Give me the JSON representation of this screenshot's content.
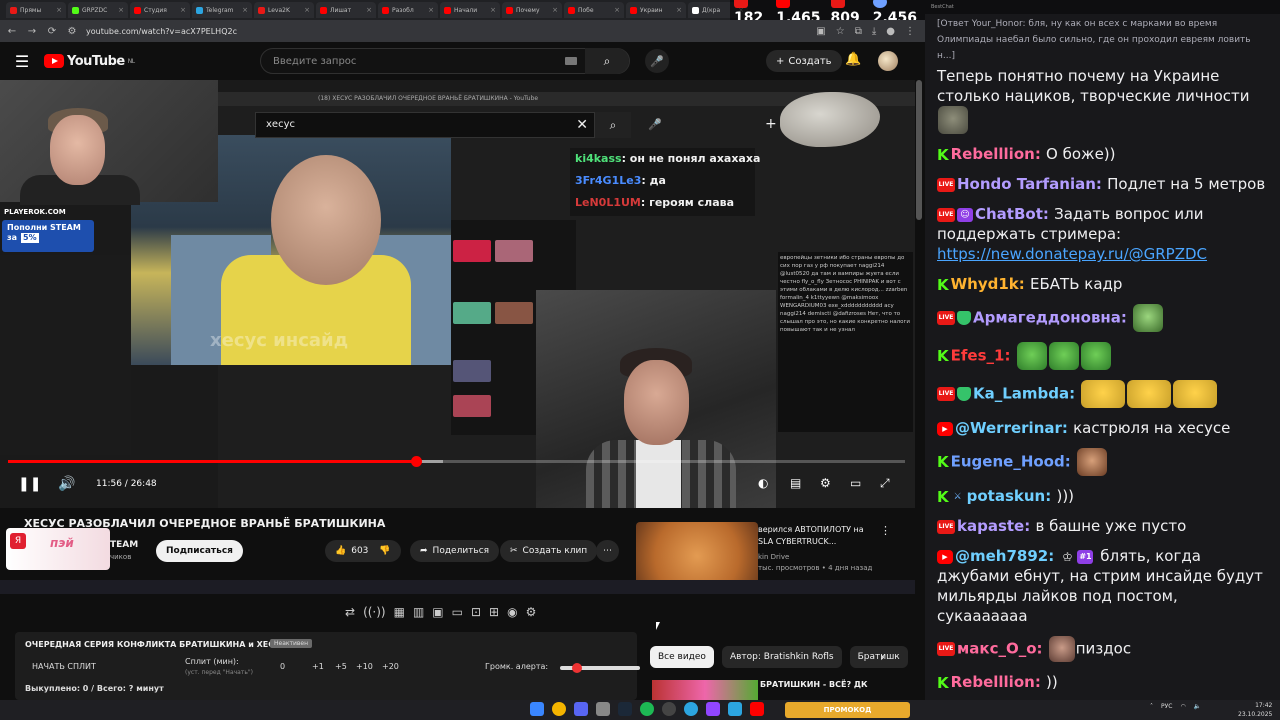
{
  "browser": {
    "tabs": [
      "Прямы",
      "GRPZDC",
      "Студия",
      "Telegram",
      "Leva2K",
      "Лишат",
      "Разобл",
      "Начали",
      "Почему",
      "Побе",
      "Украин",
      "Д(кра"
    ],
    "url": "youtube.com/watch?v=acX7PELHQ2c"
  },
  "stream_stats": {
    "kick_viewers": "182",
    "yt_viewers": "1,465",
    "live_viewers": "809",
    "followers": "2,456"
  },
  "youtube": {
    "logo_text": "YouTube",
    "logo_region": "NL",
    "search_placeholder": "Введите запрос",
    "create_label": "Создать"
  },
  "player": {
    "inner_search_value": "хесус",
    "inner_tab_title": "(18) ХЕСУС РАЗОБЛАЧИЛ ОЧЕРЕДНОЕ ВРАНЬЁ БРАТИШКИНА - YouTube",
    "watermark": "хесус инсайд",
    "playerok": "PLAYEROK.COM",
    "steam_banner_line1": "Пополни STEAM",
    "steam_banner_line2": "за",
    "steam_banner_pct": "5%",
    "overlay_chat": [
      {
        "user": "ki4kass",
        "text": ": он не понял ахахаха",
        "color": "#4fe27a"
      },
      {
        "user": "3Fr4G1Le3",
        "text": ": да",
        "color": "#4a8cff"
      },
      {
        "user": "LeN0L1UM",
        "text": ": героям слава",
        "color": "#d63a3a"
      }
    ],
    "chatlog_text": "европейцы зетники ибо страны европы до сих пор газ у рф покупает naggi214 @lust0520 да там и вампиры жуета если честно fly_o_fly Зетносос PHINIPAK и вот с этими облаками в делю кислород... zzarben formalin_4 k1ttyyewn @maksimoox WENGARDIUM03 exe_xddddddddddd асу naggi214 demiscti @dafizroses Нет, что то слышал про это, но какие конкретно налоги повышают так и не узнал",
    "progress": 0.455,
    "buffered": 0.485,
    "time_current": "11:56",
    "time_total": "26:48"
  },
  "video": {
    "title": "ХЕСУС РАЗОБЛАЧИЛ ОЧЕРЕДНОЕ ВРАНЬЁ БРАТИШКИНА",
    "channel": "TEAM",
    "subs": "чиков",
    "sponsor": "пэй",
    "subscribe_label": "Подписаться",
    "likes": "603",
    "share_label": "Поделиться",
    "clip_label": "Создать клип",
    "rec_title_line1": "верился АВТОПИЛОТУ на",
    "rec_title_line2": "SLA CYBERTRUCK...",
    "rec_channel": "kin Drive",
    "rec_meta": "тыс. просмотров • 4 дня назад"
  },
  "panel": {
    "title": "ОЧЕРЕДНАЯ СЕРИЯ КОНФЛИКТА БРАТИШКИНА и ХЕСУСА",
    "badge": "Неактивен",
    "start_split": "НАЧАТЬ СПЛИТ",
    "split_label": "Сплит (мин):",
    "split_hint": "(уст. перед \"Начать\")",
    "split_value": "0",
    "increments": [
      "+1",
      "+5",
      "+10",
      "+20"
    ],
    "alert_volume": "Громк. алерта:",
    "bought": "Выкуплено: 0 / Всего: ? минут"
  },
  "chips": [
    "Все видео",
    "Автор: Bratishkin Rofls",
    "Братишк"
  ],
  "bottom_rec": "БРАТИШКИН - ВСЁ? ДК",
  "chat": {
    "header": "BestChat",
    "messages": [
      {
        "type": "reply",
        "text": "[Ответ Your_Honor: бля, ну как он всех с марками во время Олимпиады наебал было сильно, где он проходил евреям ловить н...]"
      },
      {
        "type": "plain",
        "text": "Теперь понятно почему на Украине столько нациков, творческие личности"
      },
      {
        "badge": "k",
        "user": "Rebelllion",
        "color": "#ff6b9d",
        "text": "О боже))"
      },
      {
        "badge": "live",
        "user": "Hondo Tarfanian",
        "color": "#b39cff",
        "text": "Подлет на 5 метров"
      },
      {
        "badge": "live",
        "badge2": "robot",
        "user": "ChatBot",
        "color": "#b39cff",
        "text": "Задать вопрос или поддержать стримера:",
        "link": "https://new.donatepay.ru/@GRPZDC"
      },
      {
        "badge": "k",
        "user": "Whyd1k",
        "color": "#ffb330",
        "text": "ЕБАТЬ кадр"
      },
      {
        "badge": "live",
        "badge2": "shield",
        "user": "Армагеддоновна",
        "color": "#b39cff",
        "text": ""
      },
      {
        "badge": "k",
        "user": "Efes_1",
        "color": "#ff3b3b",
        "text": ""
      },
      {
        "badge": "live",
        "badge2": "shield",
        "user": "Ka_Lambda",
        "color": "#6fcfff",
        "text": ""
      },
      {
        "badge": "yt",
        "user": "@Werrerinar",
        "color": "#6fcfff",
        "text": "кастрюля на хесусе"
      },
      {
        "badge": "k",
        "user": "Eugene_Hood",
        "color": "#6fa0ff",
        "text": ""
      },
      {
        "badge": "k",
        "badge2": "sword",
        "user": "potaskun",
        "color": "#6fcfff",
        "text": ")))"
      },
      {
        "badge": "live",
        "user": "kapaste",
        "color": "#b39cff",
        "text": "в башне уже пусто"
      },
      {
        "badge": "yt",
        "user": "@meh7892",
        "color": "#6fcfff",
        "text": "блять, когда джубами ебнут, на стрим инсайде будут мильярды лайков под постом, сукааааааа",
        "extra": "#1"
      },
      {
        "badge": "live",
        "user": "макс_О_о",
        "color": "#ff6b9d",
        "text": "пиздос"
      },
      {
        "badge": "k",
        "user": "Rebelllion",
        "color": "#ff6b9d",
        "text": "))"
      }
    ]
  },
  "taskbar": {
    "promo": "ПРОМОКОД",
    "lang": "РУС",
    "time": "17:42",
    "date": "23.10.2025"
  }
}
